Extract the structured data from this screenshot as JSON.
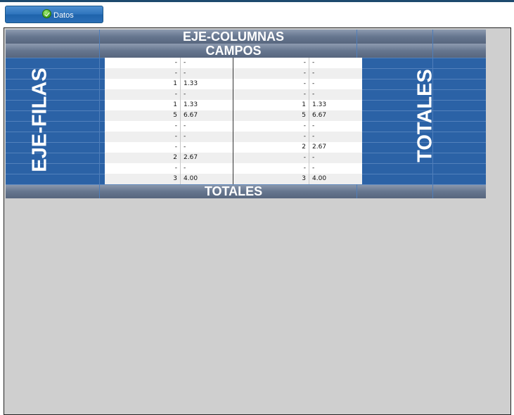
{
  "toolbar": {
    "datos_label": "Datos"
  },
  "pivot": {
    "eje_columnas": "EJE-COLUMNAS",
    "campos": "CAMPOS",
    "eje_filas": "EJE-FILAS",
    "totales_right": "TOTALES",
    "totales_bottom": "TOTALES",
    "rows": [
      [
        "-",
        "-",
        "-",
        "-"
      ],
      [
        "-",
        "-",
        "-",
        "-"
      ],
      [
        "1",
        "1.33",
        "-",
        "-"
      ],
      [
        "-",
        "-",
        "-",
        "-"
      ],
      [
        "1",
        "1.33",
        "1",
        "1.33"
      ],
      [
        "5",
        "6.67",
        "5",
        "6.67"
      ],
      [
        "-",
        "-",
        "-",
        "-"
      ],
      [
        "-",
        "-",
        "-",
        "-"
      ],
      [
        "-",
        "-",
        "2",
        "2.67"
      ],
      [
        "2",
        "2.67",
        "-",
        "-"
      ],
      [
        "-",
        "-",
        "-",
        "-"
      ],
      [
        "3",
        "4.00",
        "3",
        "4.00"
      ]
    ]
  },
  "colors": {
    "header_blue": "#2b62a6",
    "row_odd": "#ffffff",
    "row_even": "#efefef",
    "panel_bg": "#cfcfcf"
  }
}
